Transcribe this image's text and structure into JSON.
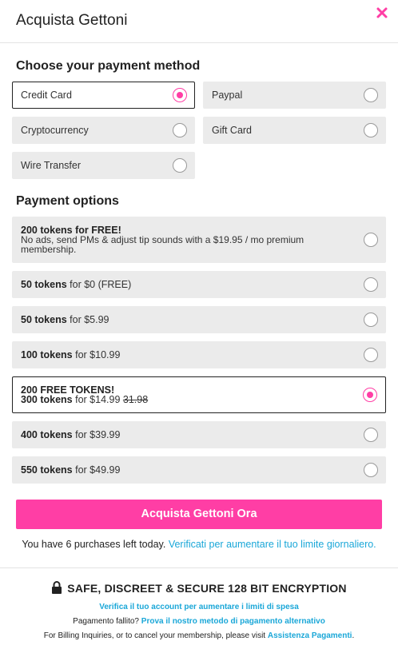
{
  "header": {
    "title": "Acquista Gettoni",
    "close_icon": "close-icon"
  },
  "methods": {
    "title": "Choose your payment method",
    "items": [
      {
        "label": "Credit Card",
        "selected": true
      },
      {
        "label": "Paypal",
        "selected": false
      },
      {
        "label": "Cryptocurrency",
        "selected": false
      },
      {
        "label": "Gift Card",
        "selected": false
      },
      {
        "label": "Wire Transfer",
        "selected": false
      }
    ]
  },
  "options": {
    "title": "Payment options",
    "items": [
      {
        "headline": "200 tokens for FREE!",
        "description": "No ads, send PMs & adjust tip sounds with a $19.95 / mo premium membership.",
        "selected": false
      },
      {
        "tokens": "50 tokens",
        "price": "for $0 (FREE)",
        "selected": false
      },
      {
        "tokens": "50 tokens",
        "price": "for $5.99",
        "selected": false
      },
      {
        "tokens": "100 tokens",
        "price": "for $10.99",
        "selected": false
      },
      {
        "promo": "200 FREE TOKENS!",
        "tokens": "300 tokens",
        "price": "for $14.99",
        "old_price": "31.98",
        "selected": true
      },
      {
        "tokens": "400 tokens",
        "price": "for $39.99",
        "selected": false
      },
      {
        "tokens": "550 tokens",
        "price": "for $49.99",
        "selected": false
      }
    ]
  },
  "purchase": {
    "button_label": "Acquista Gettoni Ora",
    "limit_text": "You have 6 purchases left today.",
    "limit_link": "Verificati per aumentare il tuo limite giornaliero."
  },
  "footer": {
    "secure_text": "SAFE, DISCREET & SECURE 128 BIT ENCRYPTION",
    "verify_link": "Verifica il tuo account per aumentare i limiti di spesa",
    "failed_text": "Pagamento fallito?",
    "failed_link": "Prova il nostro metodo di pagamento alternativo",
    "billing_text": "For Billing Inquiries, or to cancel your membership, please visit",
    "billing_link": "Assistenza Pagamenti",
    "billing_end": "."
  },
  "colors": {
    "accent": "#ff3ea5",
    "link": "#1aa7d8",
    "option_bg": "#ebebeb"
  }
}
